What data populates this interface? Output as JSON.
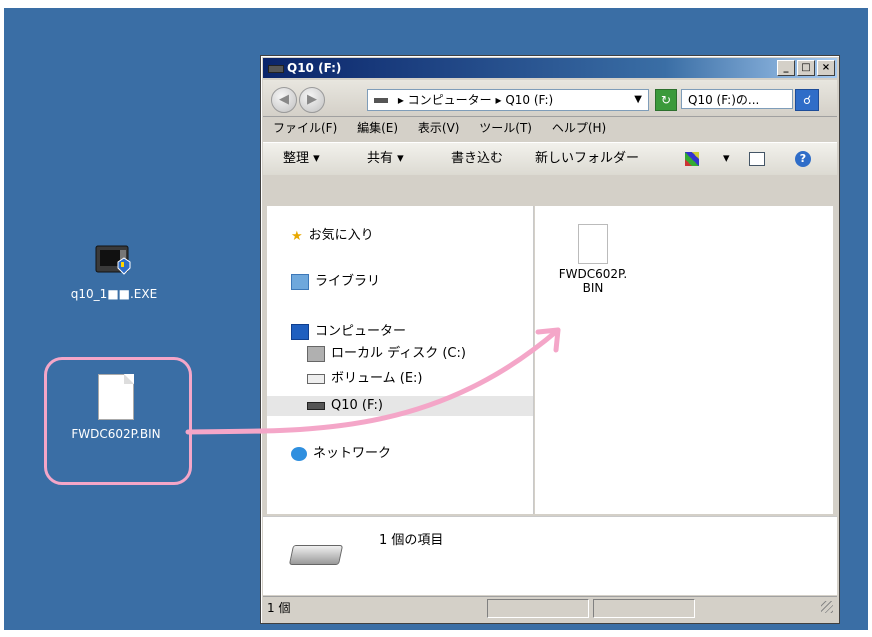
{
  "desktop": {
    "icons": [
      {
        "label": "q10_1■■.EXE",
        "name": "exe"
      },
      {
        "label": "FWDC602P.BIN",
        "name": "bin"
      }
    ]
  },
  "window": {
    "title": "Q10 (F:)",
    "buttons": {
      "minimize": "_",
      "maximize": "□",
      "close": "×"
    },
    "address": {
      "path": "▸ コンピューター ▸ Q10 (F:)",
      "search_placeholder": "Q10 (F:)の..."
    },
    "menu": [
      "ファイル(F)",
      "編集(E)",
      "表示(V)",
      "ツール(T)",
      "ヘルプ(H)"
    ],
    "toolbar": {
      "organize": "整理 ▾",
      "share": "共有 ▾",
      "burn": "書き込む",
      "new_folder": "新しいフォルダー",
      "view_dropdown": "▾",
      "help": "?"
    },
    "nav": {
      "favorites": "お気に入り",
      "libraries": "ライブラリ",
      "computer": "コンピューター",
      "local_disk": "ローカル ディスク (C:)",
      "volume": "ボリューム (E:)",
      "q10": "Q10 (F:)",
      "network": "ネットワーク"
    },
    "content": {
      "file_name_line1": "FWDC602P.",
      "file_name_line2": "BIN"
    },
    "details": {
      "count": "1 個の項目"
    },
    "status": {
      "text": "1 個"
    }
  }
}
